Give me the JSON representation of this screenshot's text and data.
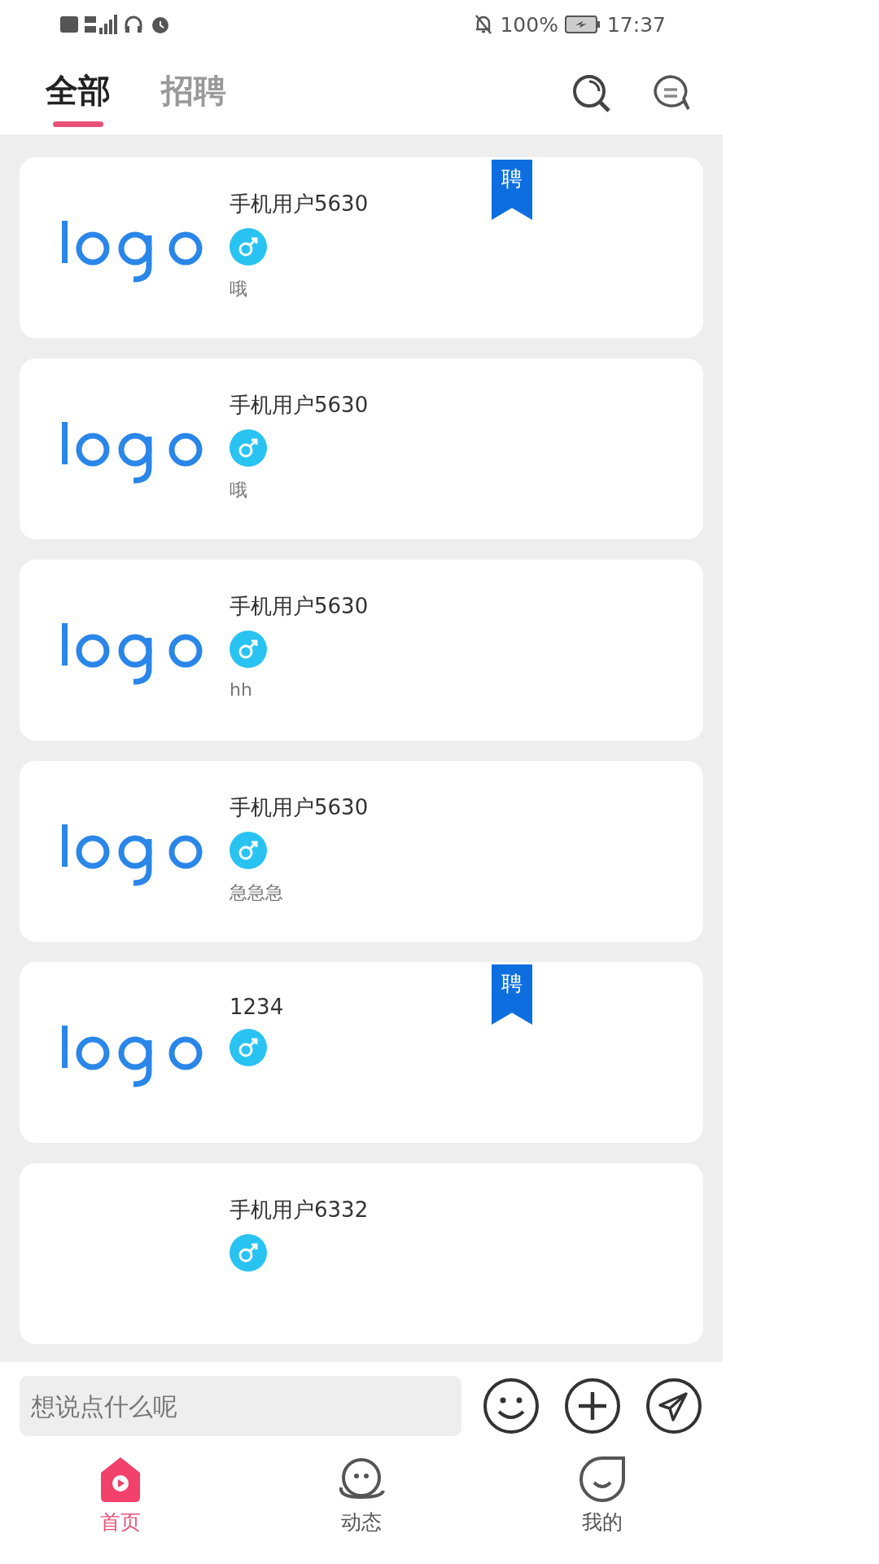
{
  "status_bar": {
    "battery": "100%",
    "time": "17:37"
  },
  "tabs": [
    {
      "label": "全部",
      "selected": true
    },
    {
      "label": "招聘",
      "selected": false
    }
  ],
  "posts": [
    {
      "name": "手机用户5630",
      "text": "哦",
      "badge": "聘"
    },
    {
      "name": "手机用户5630",
      "text": "哦"
    },
    {
      "name": "手机用户5630",
      "text": "hh"
    },
    {
      "name": "手机用户5630",
      "text": "急急急"
    },
    {
      "name": "1234",
      "badge": "聘"
    },
    {
      "name": "手机用户6332"
    }
  ],
  "composer": {
    "placeholder": "想说点什么呢"
  },
  "nav": [
    {
      "label": "首页",
      "kind": "home",
      "selected": true
    },
    {
      "label": "动态",
      "kind": "moments",
      "selected": false
    },
    {
      "label": "我的",
      "kind": "me",
      "selected": false
    }
  ]
}
